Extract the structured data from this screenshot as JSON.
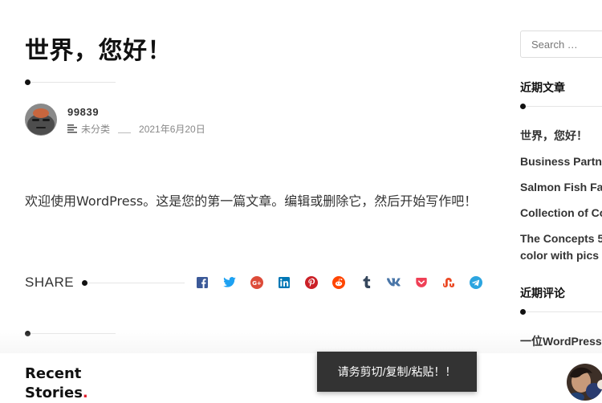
{
  "post": {
    "title": "世界，您好！",
    "author": "99839",
    "category": "未分类",
    "date": "2021年6月20日",
    "content": "欢迎使用WordPress。这是您的第一篇文章。编辑或删除它，然后开始写作吧！"
  },
  "share": {
    "label": "SHARE",
    "icons": [
      "facebook-icon",
      "twitter-icon",
      "google-plus-icon",
      "linkedin-icon",
      "pinterest-icon",
      "reddit-icon",
      "tumblr-icon",
      "vk-icon",
      "pocket-icon",
      "stumbleupon-icon",
      "telegram-icon"
    ],
    "colors": {
      "facebook": "#3b5998",
      "twitter": "#1da1f2",
      "google_plus": "#dd4b39",
      "linkedin": "#0077b5",
      "pinterest": "#cb2027",
      "reddit": "#ff4500",
      "tumblr": "#35465c",
      "vk": "#4a76a8",
      "pocket": "#ef4056",
      "stumbleupon": "#eb4924",
      "telegram": "#2ca5e0"
    }
  },
  "bottom": {
    "recent_stories_line1": "Recent",
    "recent_stories_line2": "Stories",
    "recent_stories_dot": ".",
    "toast": "请务剪切/复制/粘贴！！"
  },
  "sidebar": {
    "search_placeholder": "Search …",
    "recent_posts_title": "近期文章",
    "recent_posts": [
      "世界，您好！",
      "Business Partne",
      "Salmon Fish Far",
      "Collection of Co",
      "The Concepts 5",
      "color with pics"
    ],
    "recent_comments_title": "近期评论",
    "recent_comment": "一位WordPress评"
  },
  "colors": {
    "accent": "#e11d2b",
    "text": "#111111",
    "toast_bg": "#333333"
  }
}
